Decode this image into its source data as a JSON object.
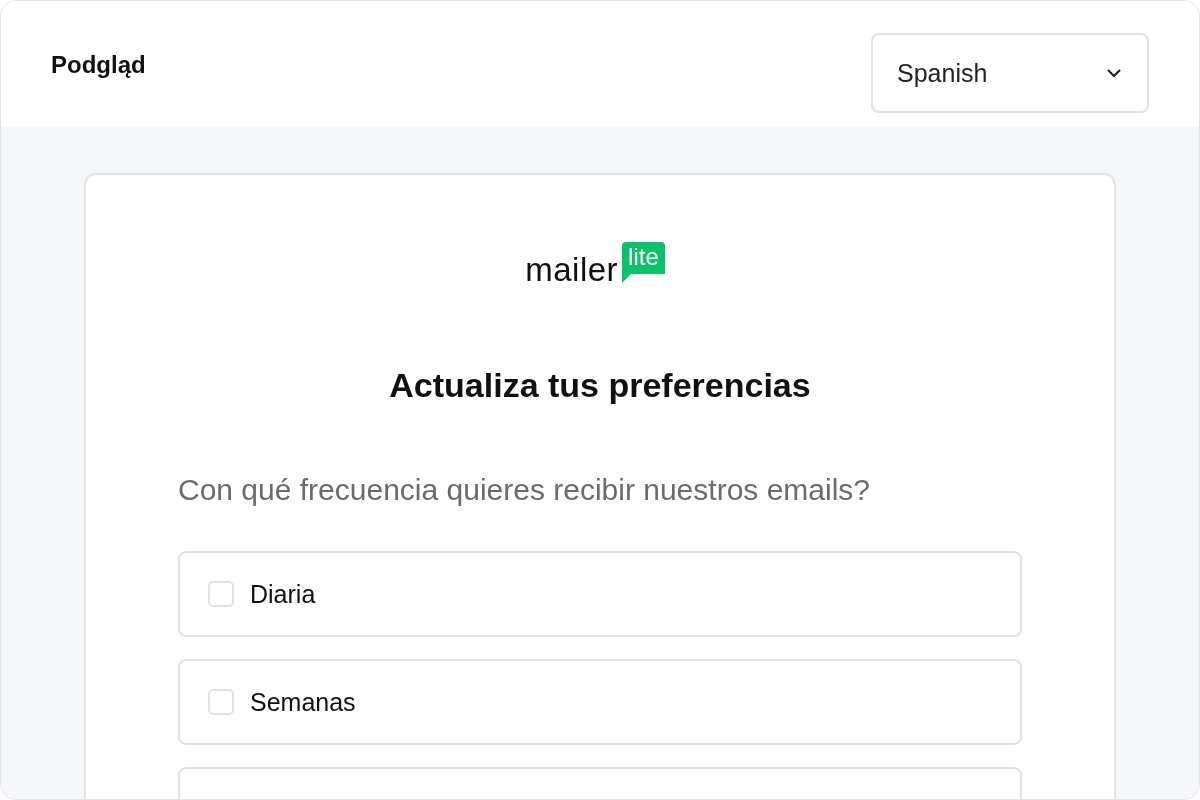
{
  "header": {
    "title": "Podgląd",
    "language_select": {
      "value": "Spanish"
    }
  },
  "form": {
    "logo": {
      "word": "mailer",
      "badge": "lite"
    },
    "title": "Actualiza tus preferencias",
    "question": "Con qué frecuencia quieres recibir nuestros emails?",
    "options": [
      {
        "label": "Diaria",
        "checked": false
      },
      {
        "label": "Semanas",
        "checked": false
      }
    ]
  }
}
